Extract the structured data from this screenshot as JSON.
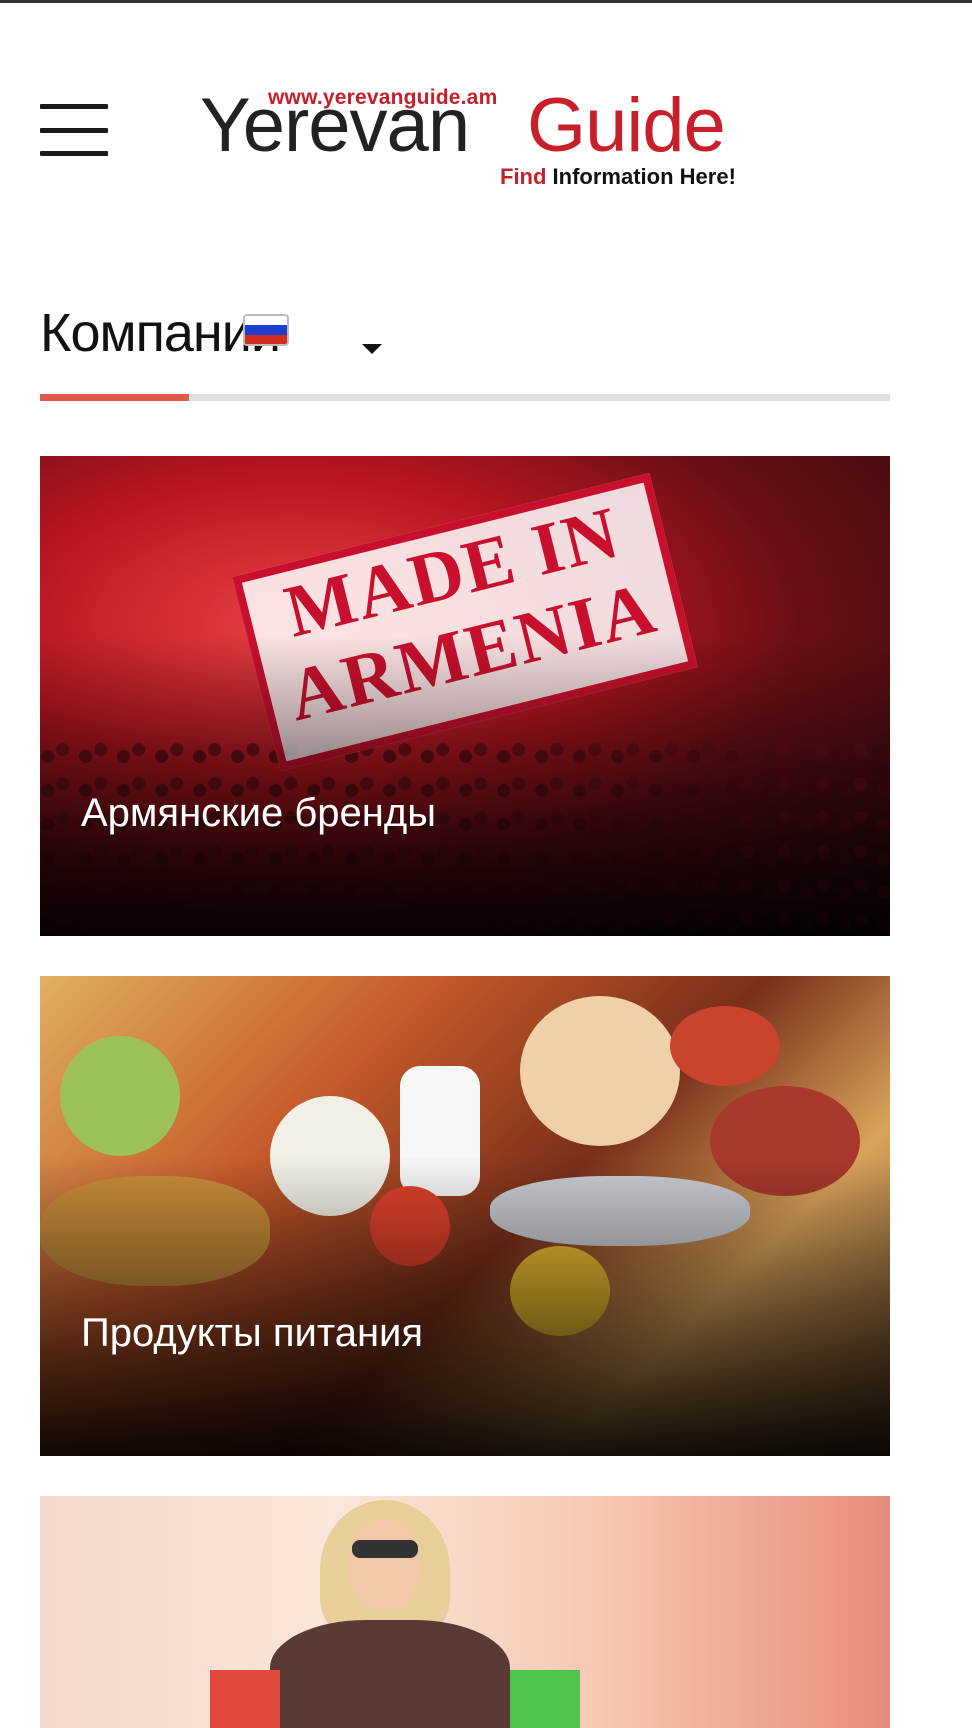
{
  "header": {
    "logo": {
      "url_text": "www.yerevanguide.am",
      "word1": "Yerevan",
      "word2": "Guide",
      "tagline_find": "Find",
      "tagline_rest": " Information Here!"
    },
    "menu_icon": "hamburger-menu-icon"
  },
  "section": {
    "title": "Компании",
    "flag_icon": "russia-flag-icon",
    "dropdown_icon": "caret-down-icon",
    "accent_color": "#e05a4b"
  },
  "cards": [
    {
      "title": "Армянские бренды",
      "image": "made-in-armenia-pomegranate",
      "stamp_line1": "MADE IN",
      "stamp_line2": "ARMENIA"
    },
    {
      "title": "Продукты питания",
      "image": "assorted-food-products"
    },
    {
      "title": "",
      "image": "woman-shopping-bags"
    }
  ],
  "colors": {
    "brand_red": "#c8202a",
    "text_dark": "#222222"
  }
}
